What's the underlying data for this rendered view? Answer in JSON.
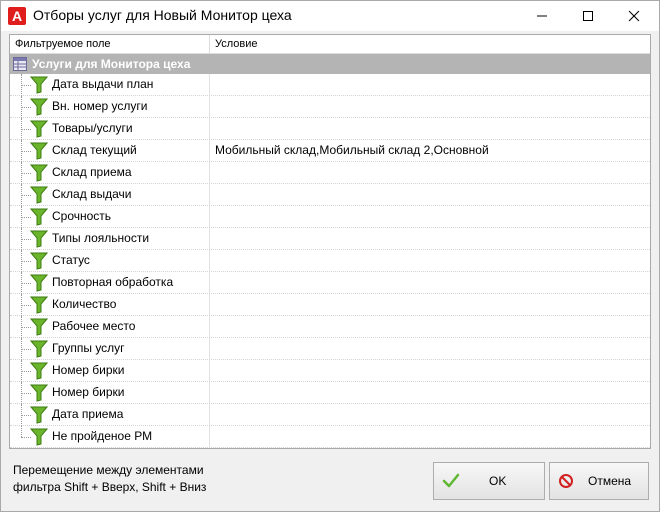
{
  "window": {
    "title": "Отборы услуг для Новый Монитор цеха",
    "app_icon_letter": "A",
    "accent_color": "#e01e1e"
  },
  "grid": {
    "columns": [
      "Фильтруемое поле",
      "Условие"
    ],
    "group": {
      "label": "Услуги для Монитора цеха",
      "color": "#b4b4b4"
    },
    "rows": [
      {
        "field": "Дата выдачи  план",
        "condition": ""
      },
      {
        "field": "Вн. номер услуги",
        "condition": ""
      },
      {
        "field": "Товары/услуги",
        "condition": ""
      },
      {
        "field": "Склад текущий",
        "condition": "Мобильный склад,Мобильный склад 2,Основной"
      },
      {
        "field": "Склад приема",
        "condition": ""
      },
      {
        "field": "Склад выдачи",
        "condition": ""
      },
      {
        "field": "Срочность",
        "condition": ""
      },
      {
        "field": "Типы лояльности",
        "condition": ""
      },
      {
        "field": "Статус",
        "condition": ""
      },
      {
        "field": "Повторная обработка",
        "condition": ""
      },
      {
        "field": "Количество",
        "condition": ""
      },
      {
        "field": "Рабочее место",
        "condition": ""
      },
      {
        "field": "Группы услуг",
        "condition": ""
      },
      {
        "field": "Номер бирки",
        "condition": ""
      },
      {
        "field": "Номер бирки",
        "condition": ""
      },
      {
        "field": "Дата приема",
        "condition": ""
      },
      {
        "field": "Не пройденое РМ",
        "condition": ""
      }
    ]
  },
  "footer": {
    "hint_line1": "Перемещение между элементами",
    "hint_line2": "фильтра Shift + Вверх, Shift + Вниз",
    "ok_label": "OK",
    "cancel_label": "Отмена"
  },
  "icons": {
    "app": "app-logo-icon",
    "row": "filter-funnel-icon",
    "group": "table-icon",
    "ok": "checkmark-icon",
    "cancel": "cancel-icon"
  }
}
